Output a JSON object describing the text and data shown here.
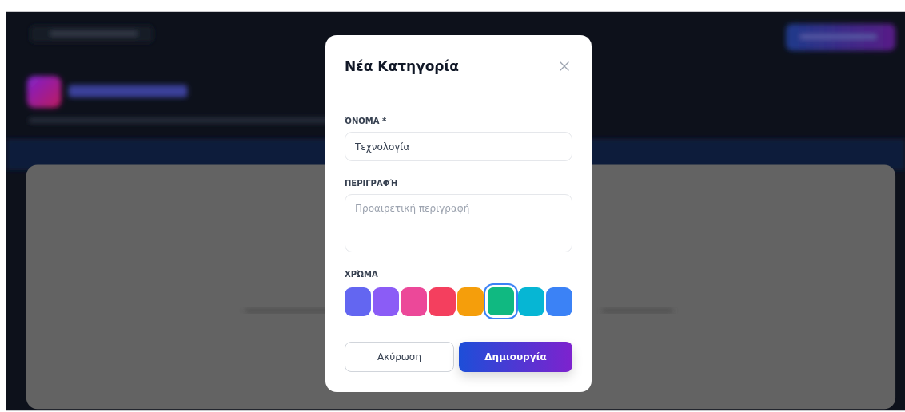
{
  "dialog": {
    "title": "Νέα Κατηγορία",
    "fields": [
      {
        "kind": "input",
        "label": "ΌΝΟΜΑ *",
        "value": "Τεχνολογία"
      },
      {
        "kind": "textarea",
        "label": "ΠΕΡΙΓΡΑΦΉ",
        "placeholder": "Προαιρετική περιγραφή"
      }
    ],
    "color_label": "ΧΡΏΜΑ",
    "colors": [
      {
        "color": "#6366f1",
        "selected": false
      },
      {
        "color": "#8b5cf6",
        "selected": false
      },
      {
        "color": "#ec4899",
        "selected": false
      },
      {
        "color": "#f43f5e",
        "selected": false
      },
      {
        "color": "#f59e0b",
        "selected": false
      },
      {
        "color": "#10b981",
        "selected": true
      },
      {
        "color": "#06b6d4",
        "selected": false
      },
      {
        "color": "#3b82f6",
        "selected": false
      }
    ],
    "buttons": [
      {
        "kind": "secondary",
        "label": "Ακύρωση"
      },
      {
        "kind": "primary",
        "label": "Δημιουργία"
      }
    ]
  }
}
